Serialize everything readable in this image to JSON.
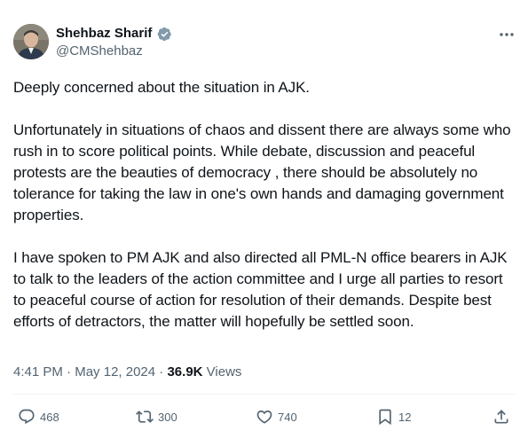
{
  "author": {
    "name": "Shehbaz Sharif",
    "handle": "@CMShehbaz",
    "verified_color": "#829aab"
  },
  "tweet": {
    "paragraphs": [
      "Deeply concerned about the situation in AJK.",
      "Unfortunately in situations of chaos and dissent there are always some who rush in to score political points. While debate, discussion and peaceful protests are the beauties of democracy , there should be absolutely no tolerance for taking the law in one's own hands and damaging government properties.",
      "I have spoken to PM AJK and also directed all PML-N office bearers in AJK to talk to the leaders of the action committee and I urge all parties to resort to peaceful course of action for resolution of their demands. Despite best efforts of detractors, the matter will hopefully be settled soon."
    ]
  },
  "meta": {
    "time": "4:41 PM",
    "separator": " · ",
    "date": "May 12, 2024",
    "views_count": "36.9K",
    "views_label": " Views"
  },
  "actions": {
    "replies": "468",
    "reposts": "300",
    "likes": "740",
    "bookmarks": "12"
  },
  "icons": [
    "avatar",
    "verified-badge-icon",
    "more-options-icon",
    "reply-icon",
    "repost-icon",
    "like-icon",
    "bookmark-icon",
    "share-icon"
  ]
}
